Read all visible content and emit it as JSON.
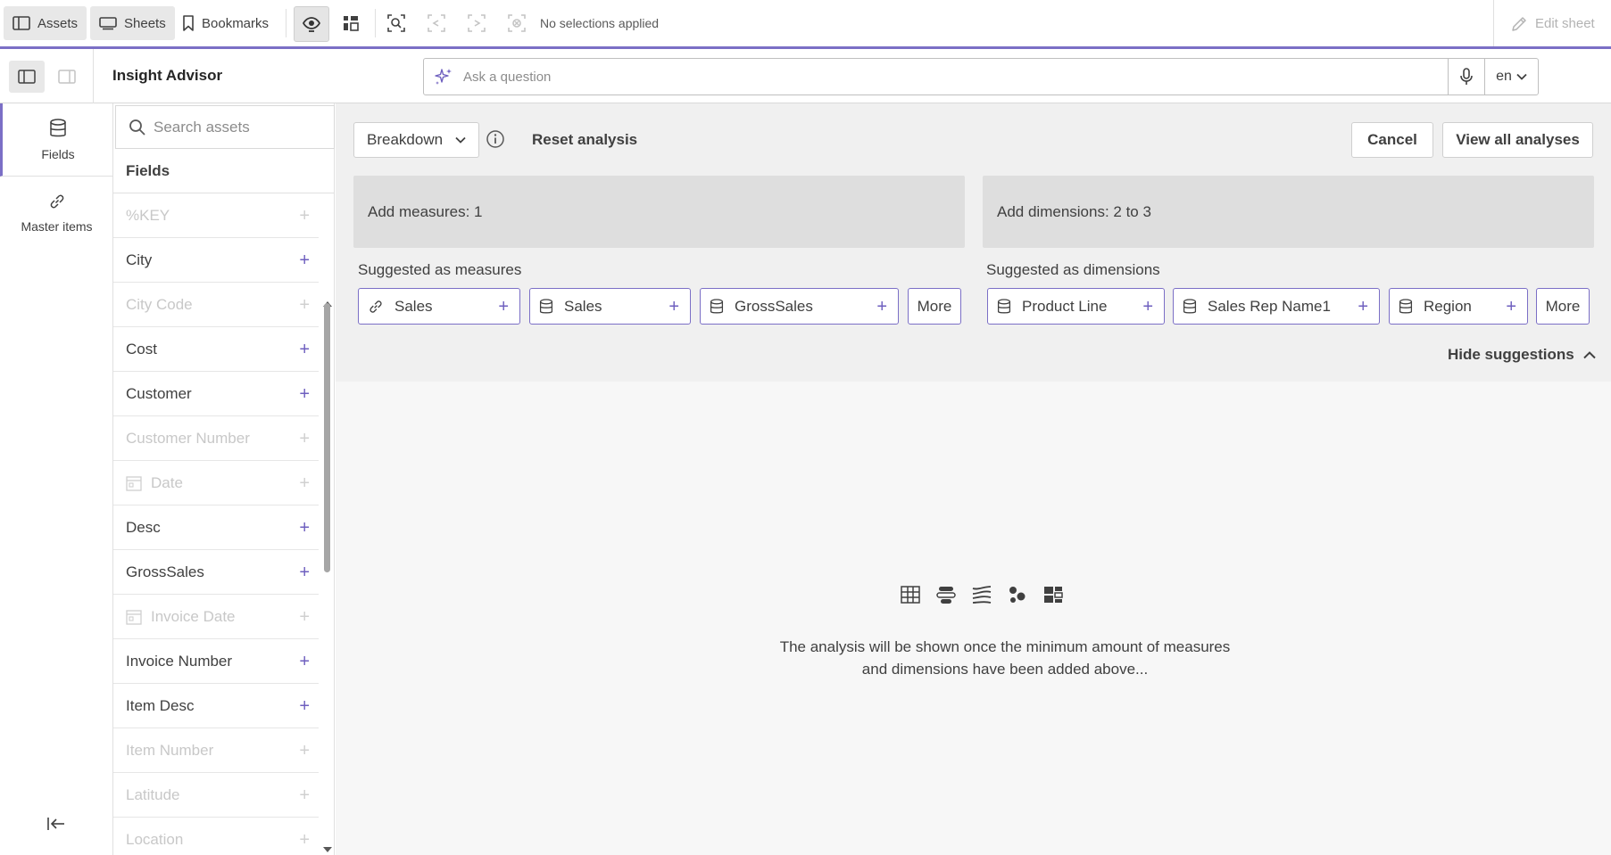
{
  "toolbar": {
    "assets_label": "Assets",
    "sheets_label": "Sheets",
    "bookmarks_label": "Bookmarks",
    "selections_status": "No selections applied",
    "edit_sheet_label": "Edit sheet"
  },
  "header": {
    "title": "Insight Advisor",
    "ask_placeholder": "Ask a question",
    "language": "en"
  },
  "rail": {
    "fields_label": "Fields",
    "master_items_label": "Master items"
  },
  "assets": {
    "search_placeholder": "Search assets",
    "section_title": "Fields",
    "fields": [
      {
        "name": "%KEY",
        "enabled": false,
        "date": false
      },
      {
        "name": "City",
        "enabled": true,
        "date": false
      },
      {
        "name": "City Code",
        "enabled": false,
        "date": false
      },
      {
        "name": "Cost",
        "enabled": true,
        "date": false
      },
      {
        "name": "Customer",
        "enabled": true,
        "date": false
      },
      {
        "name": "Customer Number",
        "enabled": false,
        "date": false
      },
      {
        "name": "Date",
        "enabled": false,
        "date": true
      },
      {
        "name": "Desc",
        "enabled": true,
        "date": false
      },
      {
        "name": "GrossSales",
        "enabled": true,
        "date": false
      },
      {
        "name": "Invoice Date",
        "enabled": false,
        "date": true
      },
      {
        "name": "Invoice Number",
        "enabled": true,
        "date": false
      },
      {
        "name": "Item Desc",
        "enabled": true,
        "date": false
      },
      {
        "name": "Item Number",
        "enabled": false,
        "date": false
      },
      {
        "name": "Latitude",
        "enabled": false,
        "date": false
      },
      {
        "name": "Location",
        "enabled": false,
        "date": false
      }
    ]
  },
  "analysis": {
    "type": "Breakdown",
    "reset_label": "Reset analysis",
    "cancel_label": "Cancel",
    "view_all_label": "View all analyses",
    "measures_dropzone": "Add measures: 1",
    "dimensions_dropzone": "Add dimensions: 2 to 3",
    "suggested_measures_label": "Suggested as measures",
    "suggested_dimensions_label": "Suggested as dimensions",
    "suggested_measures": [
      {
        "label": "Sales",
        "icon": "link-icon"
      },
      {
        "label": "Sales",
        "icon": "database-icon"
      },
      {
        "label": "GrossSales",
        "icon": "database-icon"
      }
    ],
    "suggested_dimensions": [
      {
        "label": "Product Line",
        "icon": "database-icon"
      },
      {
        "label": "Sales Rep Name1",
        "icon": "database-icon"
      },
      {
        "label": "Region",
        "icon": "database-icon"
      }
    ],
    "more_label": "More",
    "hide_suggestions_label": "Hide suggestions",
    "empty_message_line1": "The analysis will be shown once the minimum amount of measures",
    "empty_message_line2": "and dimensions have been added above..."
  },
  "colors": {
    "accent": "#7b6fc6",
    "plus": "#6e5fbf"
  }
}
